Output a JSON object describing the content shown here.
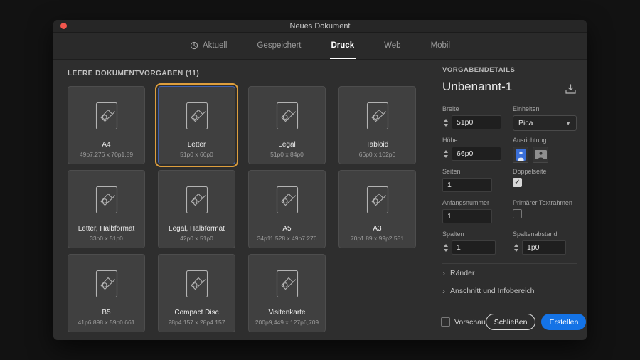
{
  "colors": {
    "accent_blue": "#1473e6",
    "selection_orange": "#dd9e3d",
    "active_tab_underline": "#ffffff"
  },
  "window": {
    "title": "Neues Dokument"
  },
  "tabs": {
    "items": [
      {
        "label": "Aktuell",
        "icon": "clock"
      },
      {
        "label": "Gespeichert"
      },
      {
        "label": "Druck",
        "active": true
      },
      {
        "label": "Web"
      },
      {
        "label": "Mobil"
      }
    ]
  },
  "presets": {
    "header": "LEERE DOKUMENTVORGABEN (11)",
    "items": [
      {
        "name": "A4",
        "size": "49p7.276 x 70p1.89"
      },
      {
        "name": "Letter",
        "size": "51p0 x 66p0",
        "selected": true
      },
      {
        "name": "Legal",
        "size": "51p0 x 84p0"
      },
      {
        "name": "Tabloid",
        "size": "66p0 x 102p0"
      },
      {
        "name": "Letter, Halbformat",
        "size": "33p0 x 51p0"
      },
      {
        "name": "Legal, Halbformat",
        "size": "42p0 x 51p0"
      },
      {
        "name": "A5",
        "size": "34p11.528 x 49p7.276"
      },
      {
        "name": "A3",
        "size": "70p1.89 x 99p2.551"
      },
      {
        "name": "B5",
        "size": "41p6.898 x 59p0.661"
      },
      {
        "name": "Compact Disc",
        "size": "28p4.157 x 28p4.157"
      },
      {
        "name": "Visitenkarte",
        "size": "200p9,449 x 127p6,709"
      }
    ]
  },
  "details": {
    "header": "VORGABENDETAILS",
    "doc_name": "Unbenannt-1",
    "fields": {
      "breite": {
        "label": "Breite",
        "value": "51p0"
      },
      "einheiten": {
        "label": "Einheiten",
        "value": "Pica"
      },
      "hoehe": {
        "label": "Höhe",
        "value": "66p0"
      },
      "ausrichtung": {
        "label": "Ausrichtung"
      },
      "seiten": {
        "label": "Seiten",
        "value": "1"
      },
      "doppelseite": {
        "label": "Doppelseite",
        "checked": true
      },
      "anfangsnummer": {
        "label": "Anfangsnummer",
        "value": "1"
      },
      "primaerer_textrahmen": {
        "label": "Primärer Textrahmen",
        "checked": false
      },
      "spalten": {
        "label": "Spalten",
        "value": "1"
      },
      "spaltenabstand": {
        "label": "Spaltenabstand",
        "value": "1p0"
      }
    },
    "sections": {
      "raender": "Ränder",
      "anschnitt": "Anschnitt und Infobereich"
    },
    "footer": {
      "vorschau": "Vorschau",
      "vorschau_checked": false,
      "schliessen": "Schließen",
      "erstellen": "Erstellen"
    }
  }
}
